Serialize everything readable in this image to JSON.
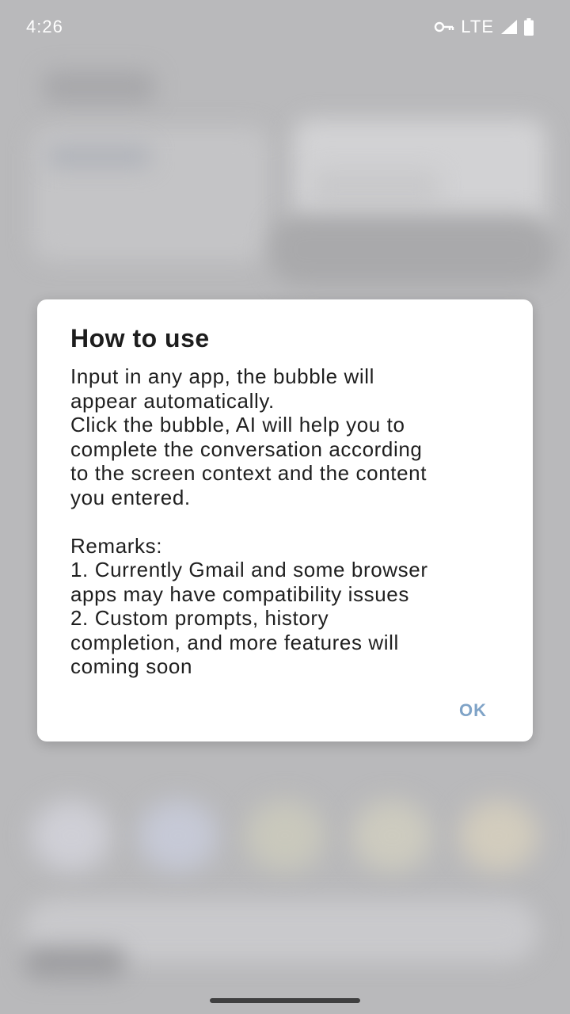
{
  "status_bar": {
    "time": "4:26",
    "network": "LTE",
    "icons": [
      "vpn-key-icon",
      "signal-icon",
      "battery-icon"
    ]
  },
  "dialog": {
    "title": "How to use",
    "body_lines": [
      "Input in any app, the bubble will",
      "appear automatically.",
      "Click the bubble, AI will help you to",
      "complete the conversation according",
      "to the screen context and the content",
      "you entered."
    ],
    "remarks_lines": [
      "Remarks:",
      "1. Currently Gmail and some browser",
      "apps may have compatibility issues",
      "2. Custom prompts, history",
      "completion, and more features will",
      "coming soon"
    ],
    "ok_label": "OK"
  },
  "colors": {
    "accent": "#7fa3c7",
    "scrim": "#b9b9bb",
    "dialog_bg": "#ffffff"
  }
}
